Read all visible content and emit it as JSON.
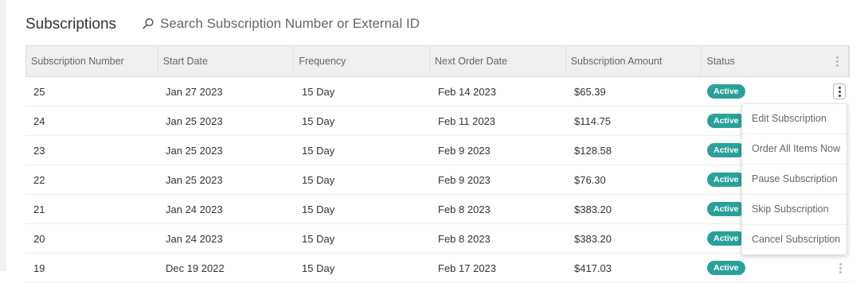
{
  "page": {
    "title": "Subscriptions",
    "search_placeholder": "Search Subscription Number or External ID"
  },
  "table": {
    "columns": [
      "Subscription Number",
      "Start Date",
      "Frequency",
      "Next Order Date",
      "Subscription Amount",
      "Status"
    ],
    "rows": [
      {
        "number": "25",
        "start": "Jan 27 2023",
        "frequency": "15 Day",
        "next": "Feb 14 2023",
        "amount": "$65.39",
        "status": "Active"
      },
      {
        "number": "24",
        "start": "Jan 25 2023",
        "frequency": "15 Day",
        "next": "Feb 11 2023",
        "amount": "$114.75",
        "status": "Active"
      },
      {
        "number": "23",
        "start": "Jan 25 2023",
        "frequency": "15 Day",
        "next": "Feb 9 2023",
        "amount": "$128.58",
        "status": "Active"
      },
      {
        "number": "22",
        "start": "Jan 25 2023",
        "frequency": "15 Day",
        "next": "Feb 9 2023",
        "amount": "$76.30",
        "status": "Active"
      },
      {
        "number": "21",
        "start": "Jan 24 2023",
        "frequency": "15 Day",
        "next": "Feb 8 2023",
        "amount": "$383.20",
        "status": "Active"
      },
      {
        "number": "20",
        "start": "Jan 24 2023",
        "frequency": "15 Day",
        "next": "Feb 8 2023",
        "amount": "$383.20",
        "status": "Active"
      },
      {
        "number": "19",
        "start": "Dec 19 2022",
        "frequency": "15 Day",
        "next": "Feb 17 2023",
        "amount": "$417.03",
        "status": "Active"
      }
    ]
  },
  "row_menu": {
    "items": [
      "Edit Subscription",
      "Order All Items Now",
      "Pause Subscription",
      "Skip Subscription",
      "Cancel Subscription"
    ]
  },
  "colors": {
    "status_active": "#2aa198"
  },
  "icons": {
    "search": "search-icon",
    "row_actions": "kebab-menu-icon"
  }
}
